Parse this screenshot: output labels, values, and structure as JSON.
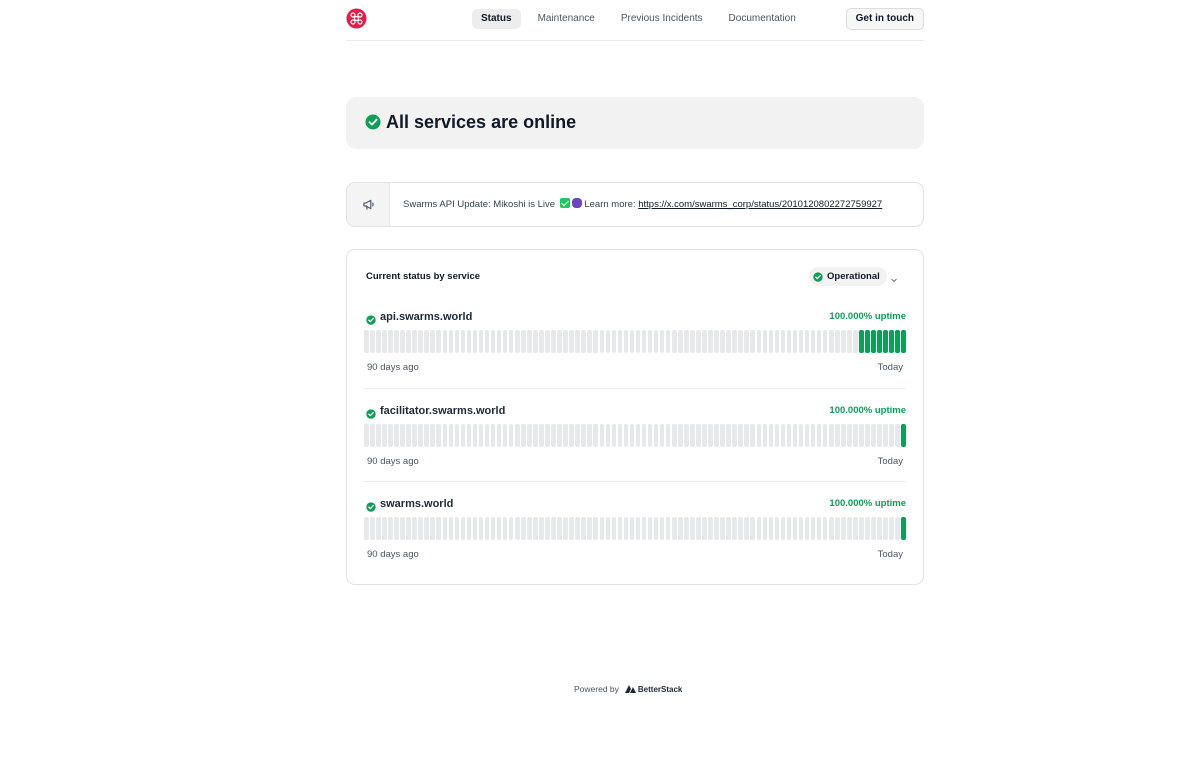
{
  "header": {
    "logo_icon": "swarms-logo-icon",
    "nav": [
      {
        "label": "Status",
        "active": true
      },
      {
        "label": "Maintenance",
        "active": false
      },
      {
        "label": "Previous Incidents",
        "active": false
      },
      {
        "label": "Documentation",
        "active": false
      }
    ],
    "cta_label": "Get in touch"
  },
  "hero": {
    "title": "All services are online",
    "icon": "check-circle-icon",
    "color": "#0f9d58"
  },
  "announcement": {
    "icon": "megaphone-icon",
    "text_before": "Swarms API Update: Mikoshi is Live",
    "text_after": "Learn more:",
    "link": "https://x.com/swarms_corp/status/2010120802272759927"
  },
  "status_card": {
    "title": "Current status by service",
    "overall_status": "Operational",
    "services": [
      {
        "name": "api.swarms.world",
        "uptime": "100.000% uptime",
        "total_days": 90,
        "green_days": 8,
        "start_label": "90 days ago",
        "end_label": "Today"
      },
      {
        "name": "facilitator.swarms.world",
        "uptime": "100.000% uptime",
        "total_days": 90,
        "green_days": 1,
        "start_label": "90 days ago",
        "end_label": "Today"
      },
      {
        "name": "swarms.world",
        "uptime": "100.000% uptime",
        "total_days": 90,
        "green_days": 1,
        "start_label": "90 days ago",
        "end_label": "Today"
      }
    ]
  },
  "footer": {
    "powered_by": "Powered by",
    "brand": "BetterStack"
  },
  "colors": {
    "operational_green": "#0f9d58",
    "no_data_gray": "#e7e8ea"
  }
}
